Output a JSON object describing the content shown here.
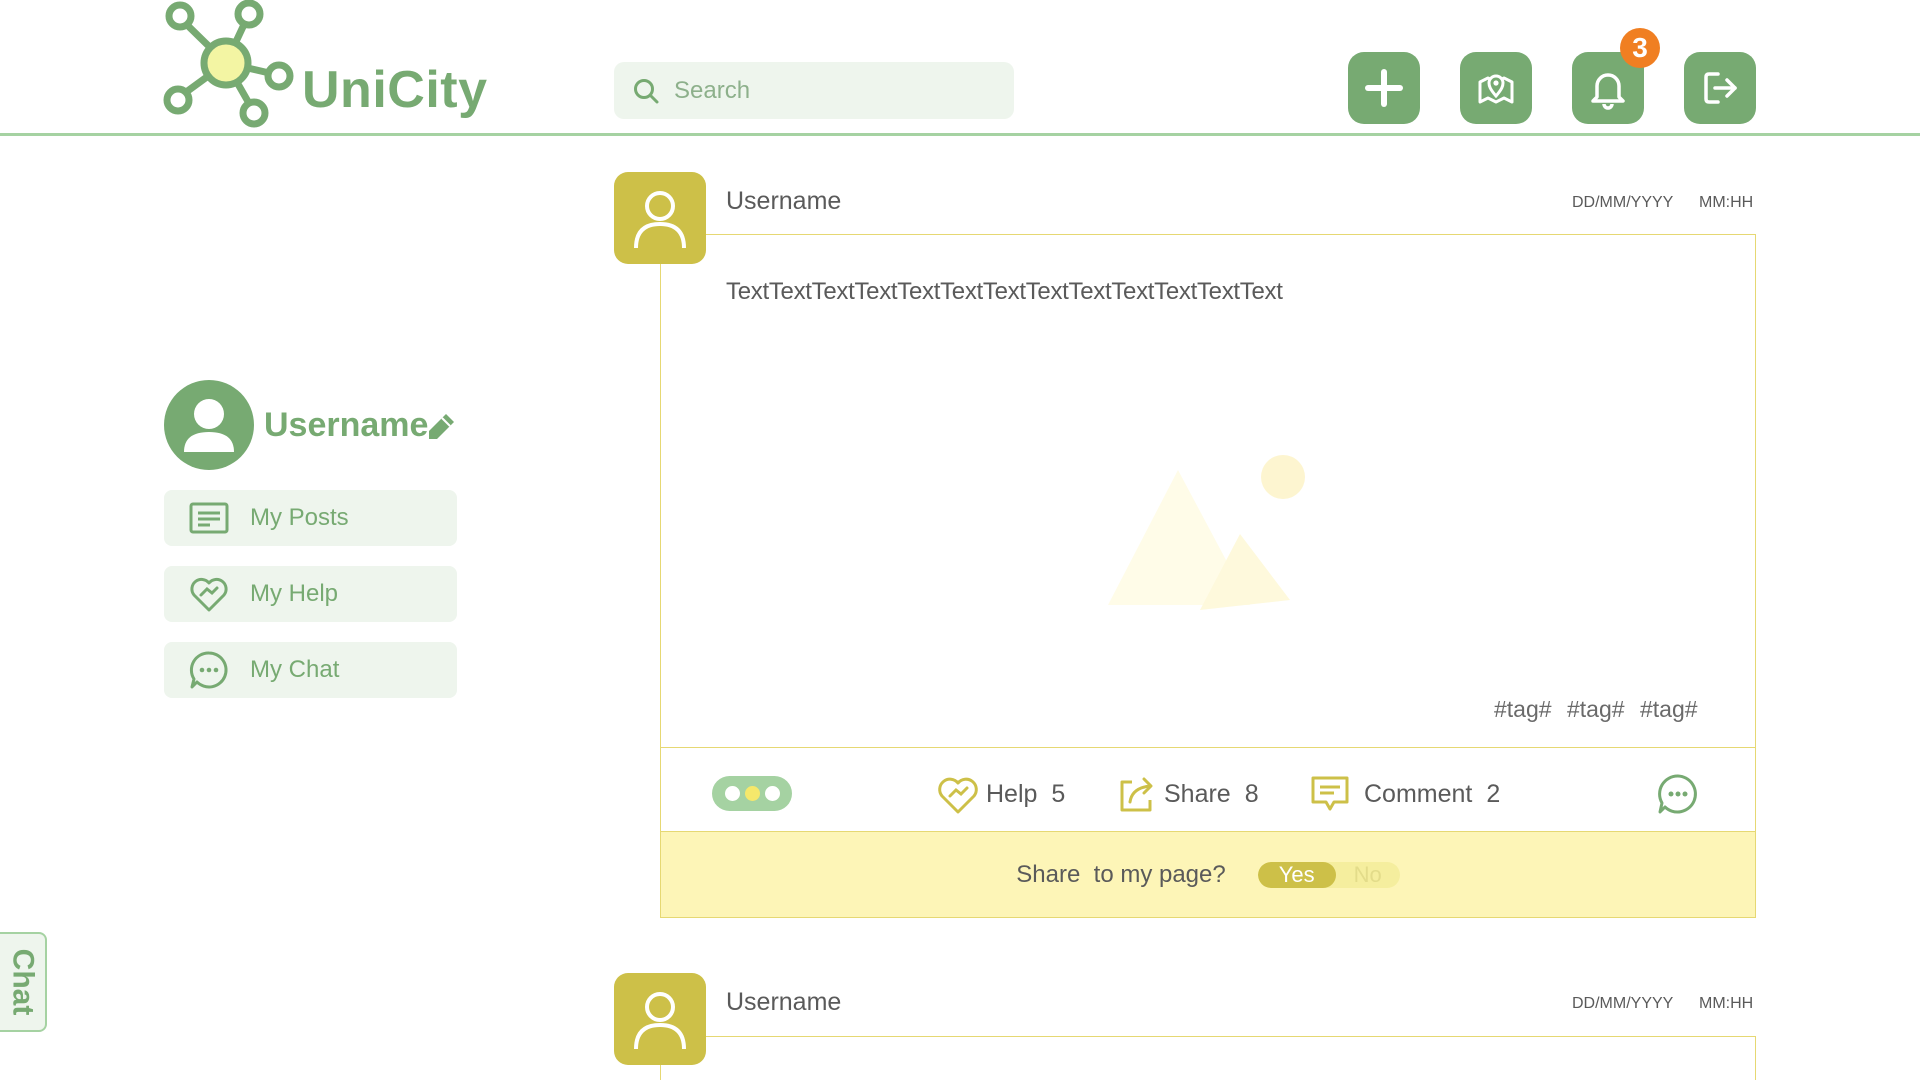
{
  "header": {
    "app_name": "UniCity",
    "search_placeholder": "Search",
    "notification_count": "3",
    "buttons": [
      {
        "icon": "plus-icon"
      },
      {
        "icon": "map-pin-icon"
      },
      {
        "icon": "bell-icon"
      },
      {
        "icon": "logout-icon"
      }
    ]
  },
  "sidebar": {
    "username": "Username",
    "items": [
      {
        "label": "My Posts",
        "icon": "posts-icon"
      },
      {
        "label": "My Help",
        "icon": "heart-handshake-icon"
      },
      {
        "label": "My Chat",
        "icon": "chat-bubble-icon"
      }
    ],
    "chat_tab": "Chat"
  },
  "posts": [
    {
      "username": "Username",
      "date": "DD/MM/YYYY",
      "time": "MM:HH",
      "text": "TextTextTextTextTextTextTextTextTextTextTextTextText",
      "tags": [
        "#tag#",
        "#tag#",
        "#tag#"
      ],
      "actions": {
        "help_label": "Help",
        "help_count": "5",
        "share_label": "Share",
        "share_count": "8",
        "comment_label": "Comment",
        "comment_count": "2"
      },
      "share_prompt": {
        "question": "Share  to my page?",
        "yes": "Yes",
        "no": "No",
        "selected": "Yes"
      }
    },
    {
      "username": "Username",
      "date": "DD/MM/YYYY",
      "time": "MM:HH"
    }
  ],
  "colors": {
    "primary_green": "#77aa72",
    "light_green": "#eef5ed",
    "border_green": "#a5d2a2",
    "olive": "#cdc048",
    "pale_yellow": "#fdf5b7",
    "badge_orange": "#f07f22"
  }
}
